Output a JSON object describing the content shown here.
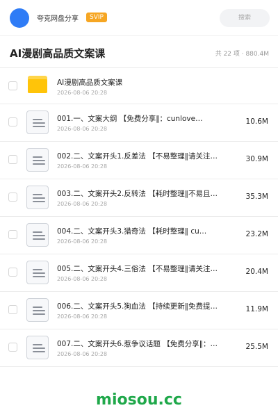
{
  "header": {
    "username": "夸克网盘分享",
    "badge": "SVIP",
    "search_placeholder": "搜索"
  },
  "folder": {
    "title": "AI漫剧高品质文案课",
    "meta": "共 22 项 · 880.4M"
  },
  "files": [
    {
      "name": "AI漫剧高品质文案课",
      "date": "2026-08-06 20:28",
      "size": "",
      "type": "folder"
    },
    {
      "name": "001.一、文案大纲 【免费分享‖：cunlove…",
      "date": "2026-08-06 20:28",
      "size": "10.6M",
      "type": "doc"
    },
    {
      "name": "002.二、文案开头1.反差法 【不易整理‖请关注…",
      "date": "2026-08-06 20:28",
      "size": "30.9M",
      "type": "doc"
    },
    {
      "name": "003.二、文案开头2.反转法 【耗时整理‖不易且…",
      "date": "2026-08-06 20:28",
      "size": "35.3M",
      "type": "doc"
    },
    {
      "name": "004.二、文案开头3.猎奇法 【耗时整理‖ cu…",
      "date": "2026-08-06 20:28",
      "size": "23.2M",
      "type": "doc"
    },
    {
      "name": "005.二、文案开头4.三俗法 【不易整理‖请关注…",
      "date": "2026-08-06 20:28",
      "size": "20.4M",
      "type": "doc"
    },
    {
      "name": "006.二、文案开头5.狗血法 【持续更新‖免费提…",
      "date": "2026-08-06 20:28",
      "size": "11.9M",
      "type": "doc"
    },
    {
      "name": "007.二、文案开头6.惹争议话题 【免费分享‖：…",
      "date": "2026-08-06 20:28",
      "size": "25.5M",
      "type": "doc"
    }
  ],
  "watermark": "miosou.cc",
  "colors": {
    "avatar": "#2f7cf6",
    "badge": "#f6a623",
    "folder": "#ffc409",
    "watermark": "#1fa84a"
  }
}
